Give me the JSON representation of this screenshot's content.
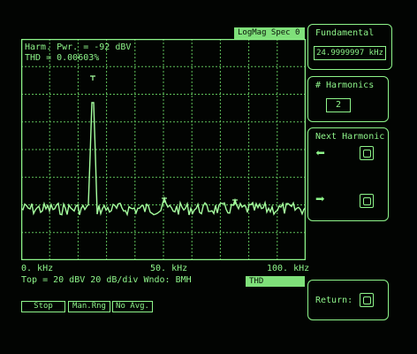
{
  "header": {
    "mode_label": "LogMag Spec  0"
  },
  "plot": {
    "harm_pwr": "Harm. Pwr. = -92 dBV",
    "thd": "THD = 0.00603%",
    "x_start": "0. kHz",
    "x_mid": "50. kHz",
    "x_end": "100. kHz",
    "scale_info": "Top = 20 dBV  20 dB/div  Wndo: BMH"
  },
  "status": {
    "thd_label": "THD"
  },
  "softkeys": {
    "fundamental": {
      "title": "Fundamental",
      "value": "24.9999997 kHz"
    },
    "harmonics": {
      "title": "# Harmonics",
      "value": "2"
    },
    "next_harmonic": {
      "title": "Next Harmonic"
    },
    "return": {
      "label": "Return:"
    }
  },
  "bottom_keys": {
    "stop": "Stop",
    "man_rng": "Man.Rng",
    "no_avg": "No Avg."
  }
}
